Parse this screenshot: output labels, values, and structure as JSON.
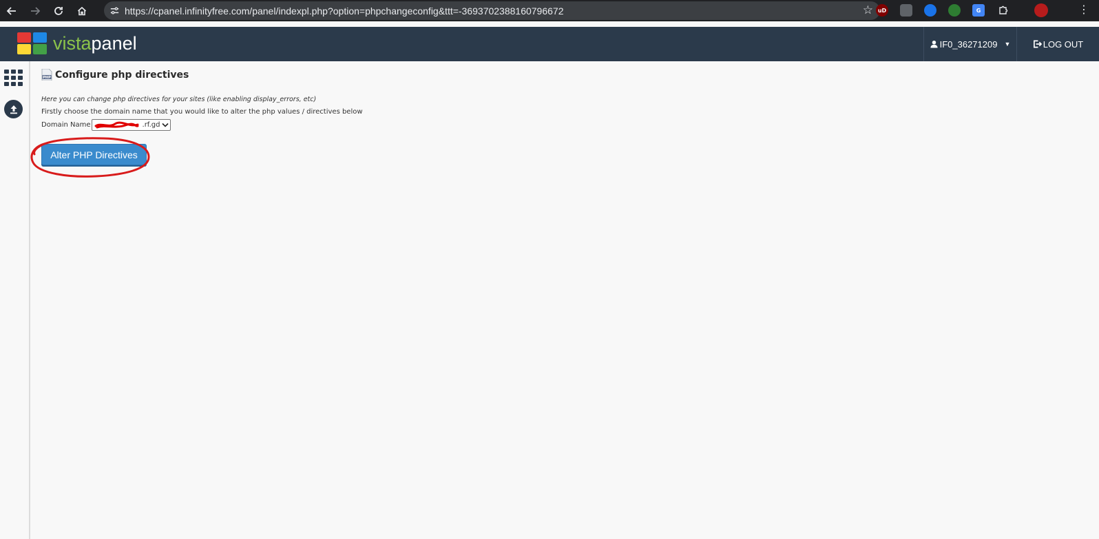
{
  "browser": {
    "url": "https://cpanel.infinityfree.com/panel/indexpl.php?option=phpchangeconfig&ttt=-3693702388160796672",
    "extensions": [
      {
        "name": "ublock-extension-icon",
        "color": "#800000",
        "label": "uD"
      },
      {
        "name": "shield-extension-icon",
        "color": "#5f6368",
        "label": ""
      },
      {
        "name": "shazam-extension-icon",
        "color": "#1a73e8",
        "label": ""
      },
      {
        "name": "globe-extension-icon",
        "color": "#2e7d32",
        "label": ""
      },
      {
        "name": "translate-extension-icon",
        "color": "#4285f4",
        "label": "G"
      },
      {
        "name": "puzzle-extension-icon",
        "color": "#3c4043",
        "label": ""
      },
      {
        "name": "profile-avatar-icon",
        "color": "#b71c1c",
        "label": ""
      }
    ]
  },
  "header": {
    "logo_part1": "vista",
    "logo_part2": "panel",
    "username": "IF0_36271209",
    "logout_label": "LOG OUT",
    "bg_color": "#2b3a4b",
    "logo_green": "#8bc34a"
  },
  "sidebar": {
    "items": [
      {
        "name": "apps-grid-icon"
      },
      {
        "name": "upload-icon"
      }
    ]
  },
  "main": {
    "title": "Configure php directives",
    "description_italic": "Here you can change php directives for your sites (like enabling display_errors, etc)",
    "description": "Firstly choose the domain name that you would like to alter the php values / directives below",
    "domain_label": "Domain Name",
    "domain_selected_value": ".rf.gd",
    "button_label": "Alter PHP Directives",
    "button_color": "#3a8bcd",
    "annotation_color": "#d81b1b"
  }
}
